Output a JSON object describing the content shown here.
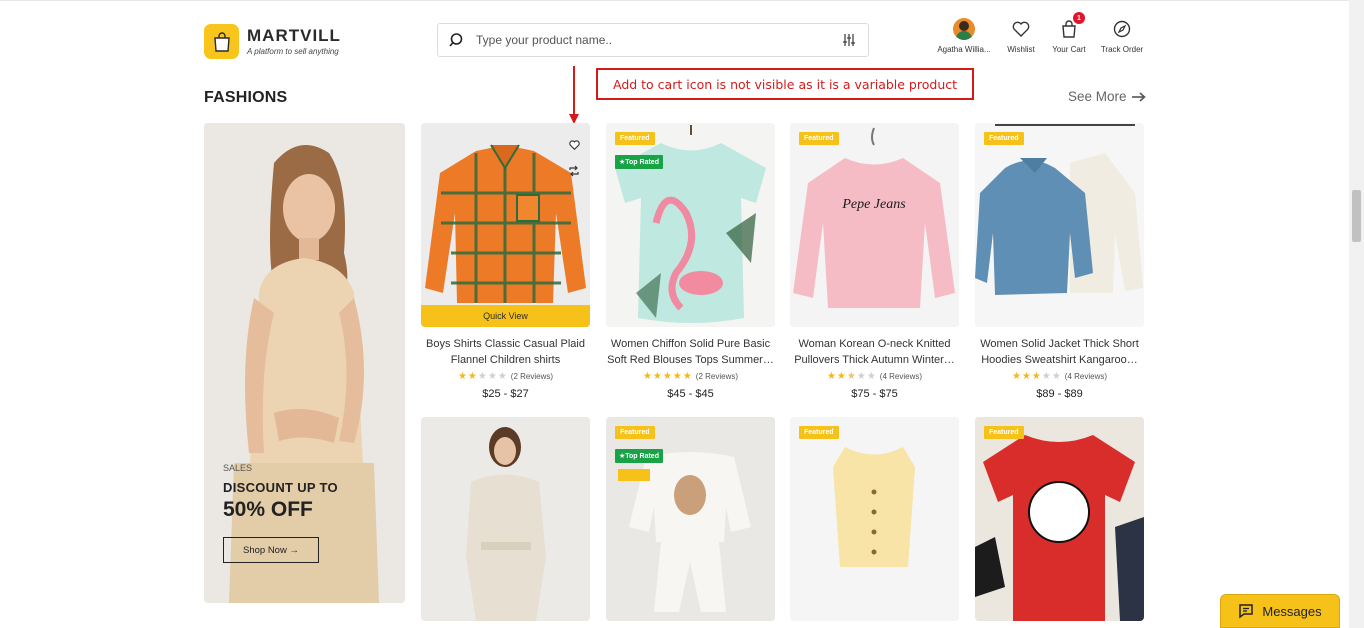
{
  "brand": {
    "name": "MARTVILL",
    "tagline": "A platform to sell anything"
  },
  "search": {
    "placeholder": "Type your product name.."
  },
  "header": {
    "user_label": "Agatha Willia...",
    "wishlist_label": "Wishlist",
    "cart_label": "Your Cart",
    "cart_count": "1",
    "track_label": "Track Order"
  },
  "annotation": {
    "text": "Add to cart icon is not visible as it is a variable product"
  },
  "section": {
    "title": "FASHIONS",
    "see_more": "See More"
  },
  "banner": {
    "sales": "SALES",
    "discount": "DISCOUNT UP TO",
    "off": "50% OFF",
    "button": "Shop Now →"
  },
  "products": [
    {
      "name": "Boys Shirts Classic Casual Plaid Flannel Children shirts",
      "stars": 2,
      "reviews": "(2 Reviews)",
      "price": "$25 - $27",
      "featured": "",
      "top_rated": "",
      "quick_view": "Quick View"
    },
    {
      "name": "Women Chiffon Solid Pure Basic Soft Red Blouses Tops Summer…",
      "stars": 5,
      "reviews": "(2 Reviews)",
      "price": "$45 - $45",
      "featured": "Featured",
      "top_rated": "★Top Rated"
    },
    {
      "name": "Woman Korean O-neck Knitted Pullovers Thick Autumn Winter…",
      "stars": 2.5,
      "reviews": "(4 Reviews)",
      "price": "$75 - $75",
      "featured": "Featured",
      "top_rated": ""
    },
    {
      "name": "Women Solid Jacket Thick Short Hoodies Sweatshirt Kangaroo…",
      "stars": 3,
      "reviews": "(4 Reviews)",
      "price": "$89 - $89",
      "featured": "Featured",
      "top_rated": ""
    },
    {
      "name": "",
      "featured": "",
      "top_rated": ""
    },
    {
      "name": "",
      "featured": "Featured",
      "top_rated": "★Top Rated"
    },
    {
      "name": "",
      "featured": "Featured",
      "top_rated": ""
    },
    {
      "name": "",
      "featured": "Featured",
      "top_rated": ""
    }
  ],
  "messages": {
    "label": "Messages"
  },
  "colors": {
    "accent": "#f6c21a",
    "top_rated": "#17a346",
    "annotation": "#d51a1a"
  }
}
